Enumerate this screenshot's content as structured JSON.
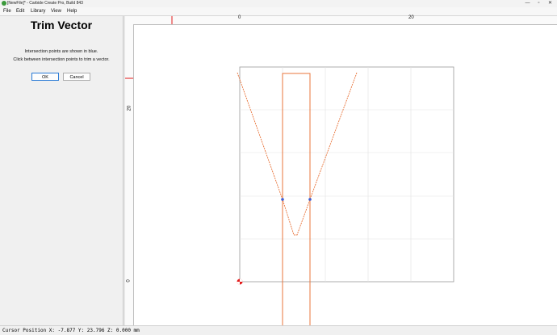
{
  "window": {
    "title": "[NewFile]* - Carbide Create Pro, Build 843"
  },
  "menu": [
    "File",
    "Edit",
    "Library",
    "View",
    "Help"
  ],
  "panel": {
    "title": "Trim Vector",
    "line1": "Intersection points are shown in blue.",
    "line2": "Click between intersection points to trim a vector.",
    "ok": "OK",
    "cancel": "Cancel"
  },
  "rulers": {
    "x0": "0",
    "x20": "20",
    "y20": "20",
    "y0": "0"
  },
  "status": {
    "text": "Cursor Position X: -7.877 Y: 23.796 Z: 0.000 mm"
  },
  "colors": {
    "vector": "#e8743b",
    "intersection": "#3d5fd6",
    "origin": "#e31b1b",
    "grid": "#e2e2e2"
  }
}
